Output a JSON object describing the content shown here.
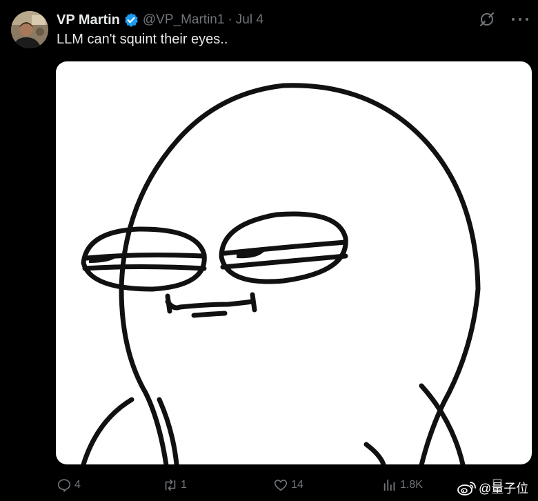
{
  "author": {
    "name": "VP Martin",
    "handle": "@VP_Martin1",
    "separator": "·",
    "date": "Jul 4"
  },
  "tweet": {
    "text": "LLM can't squint their eyes.."
  },
  "metrics": {
    "replies": "4",
    "reposts": "1",
    "likes": "14",
    "views": "1.8K"
  },
  "watermark": {
    "text": "@量子位"
  },
  "icons": {
    "verified": "verified-badge-icon",
    "grok": "grok-icon",
    "more": "more-icon",
    "reply": "reply-icon",
    "repost": "repost-icon",
    "like": "like-icon",
    "views": "views-icon",
    "bookmark": "bookmark-icon",
    "weibo": "weibo-icon"
  },
  "colors": {
    "background": "#000000",
    "text_primary": "#e7e9ea",
    "text_secondary": "#71767b",
    "verified": "#1d9bf0"
  }
}
